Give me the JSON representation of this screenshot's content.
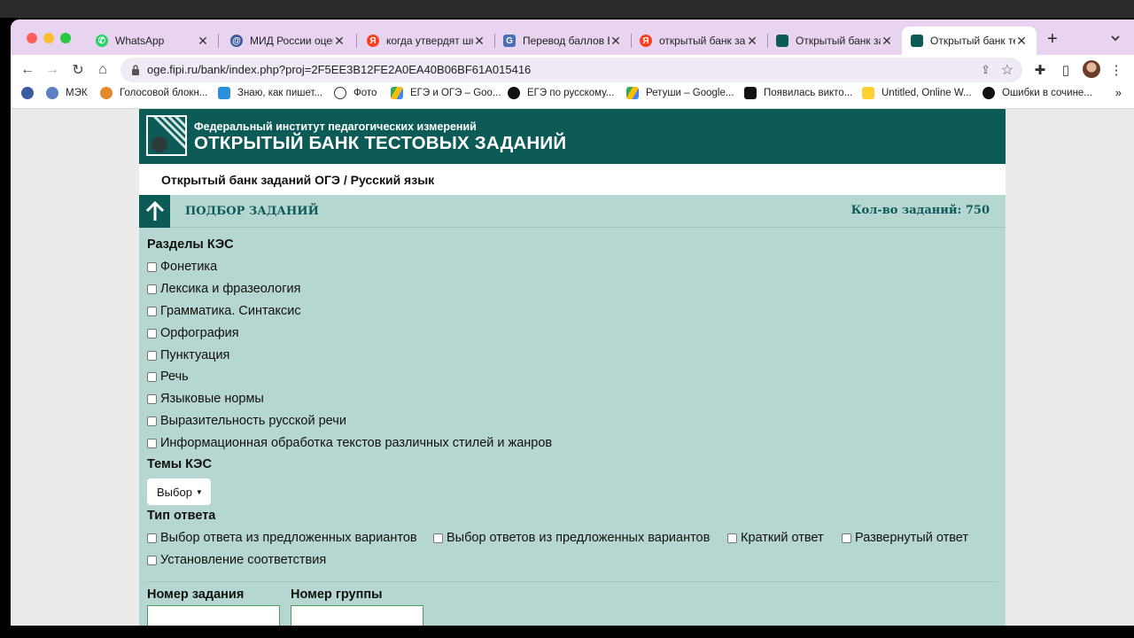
{
  "browser": {
    "tabs": [
      {
        "title": "WhatsApp",
        "favicon_color": "#25d366",
        "active": false
      },
      {
        "title": "МИД России оцен",
        "favicon_color": "#3a5ba0",
        "active": false
      },
      {
        "title": "когда утвердят шк",
        "favicon_color": "#fc3f1d",
        "active": false
      },
      {
        "title": "Перевод баллов Е",
        "favicon_color": "#4a6fb5",
        "active": false
      },
      {
        "title": "открытый банк за",
        "favicon_color": "#fc3f1d",
        "active": false
      },
      {
        "title": "Открытый банк за",
        "favicon_color": "#0c5b57",
        "active": false
      },
      {
        "title": "Открытый банк те",
        "favicon_color": "#0c5b57",
        "active": true
      }
    ],
    "url": "oge.fipi.ru/bank/index.php?proj=2F5EE3B12FE2A0EA40B06BF61A015416",
    "bookmarks": [
      {
        "label": "",
        "icon": "circle-at-icon"
      },
      {
        "label": "МЭК",
        "icon": "eye-icon"
      },
      {
        "label": "Голосовой блокн...",
        "icon": "voice-icon"
      },
      {
        "label": "Знаю, как пишет...",
        "icon": "grid-icon"
      },
      {
        "label": "Фото",
        "icon": "camera-icon"
      },
      {
        "label": "ЕГЭ и ОГЭ – Goo...",
        "icon": "drive-icon"
      },
      {
        "label": "ЕГЭ по русскому...",
        "icon": "link-icon"
      },
      {
        "label": "Ретуши – Google...",
        "icon": "drive-icon"
      },
      {
        "label": "Появилась викто...",
        "icon": "q-icon"
      },
      {
        "label": "Untitled, Online W...",
        "icon": "miro-icon"
      },
      {
        "label": "Ошибки в сочине...",
        "icon": "plus-circle-icon"
      }
    ]
  },
  "site": {
    "header_sub": "Федеральный институт педагогических измерений",
    "header_title": "ОТКРЫТЫЙ БАНК ТЕСТОВЫХ ЗАДАНИЙ",
    "breadcrumb": "Открытый банк заданий ОГЭ / Русский язык",
    "filter_title": "ПОДБОР ЗАДАНИЙ",
    "count_label": "Кол-во заданий: 750",
    "kes_sections_title": "Разделы КЭС",
    "kes_sections": [
      "Фонетика",
      "Лексика и фразеология",
      "Грамматика. Синтаксис",
      "Орфография",
      "Пунктуация",
      "Речь",
      "Языковые нормы",
      "Выразительность русской речи",
      "Информационная обработка текстов различных стилей и жанров"
    ],
    "kes_topics_title": "Темы КЭС",
    "select_label": "Выбор",
    "answer_type_title": "Тип ответа",
    "answer_types": [
      "Выбор ответа из предложенных вариантов",
      "Выбор ответов из предложенных вариантов",
      "Краткий ответ",
      "Развернутый ответ",
      "Установление соответствия"
    ],
    "task_number_label": "Номер задания",
    "group_number_label": "Номер группы"
  }
}
